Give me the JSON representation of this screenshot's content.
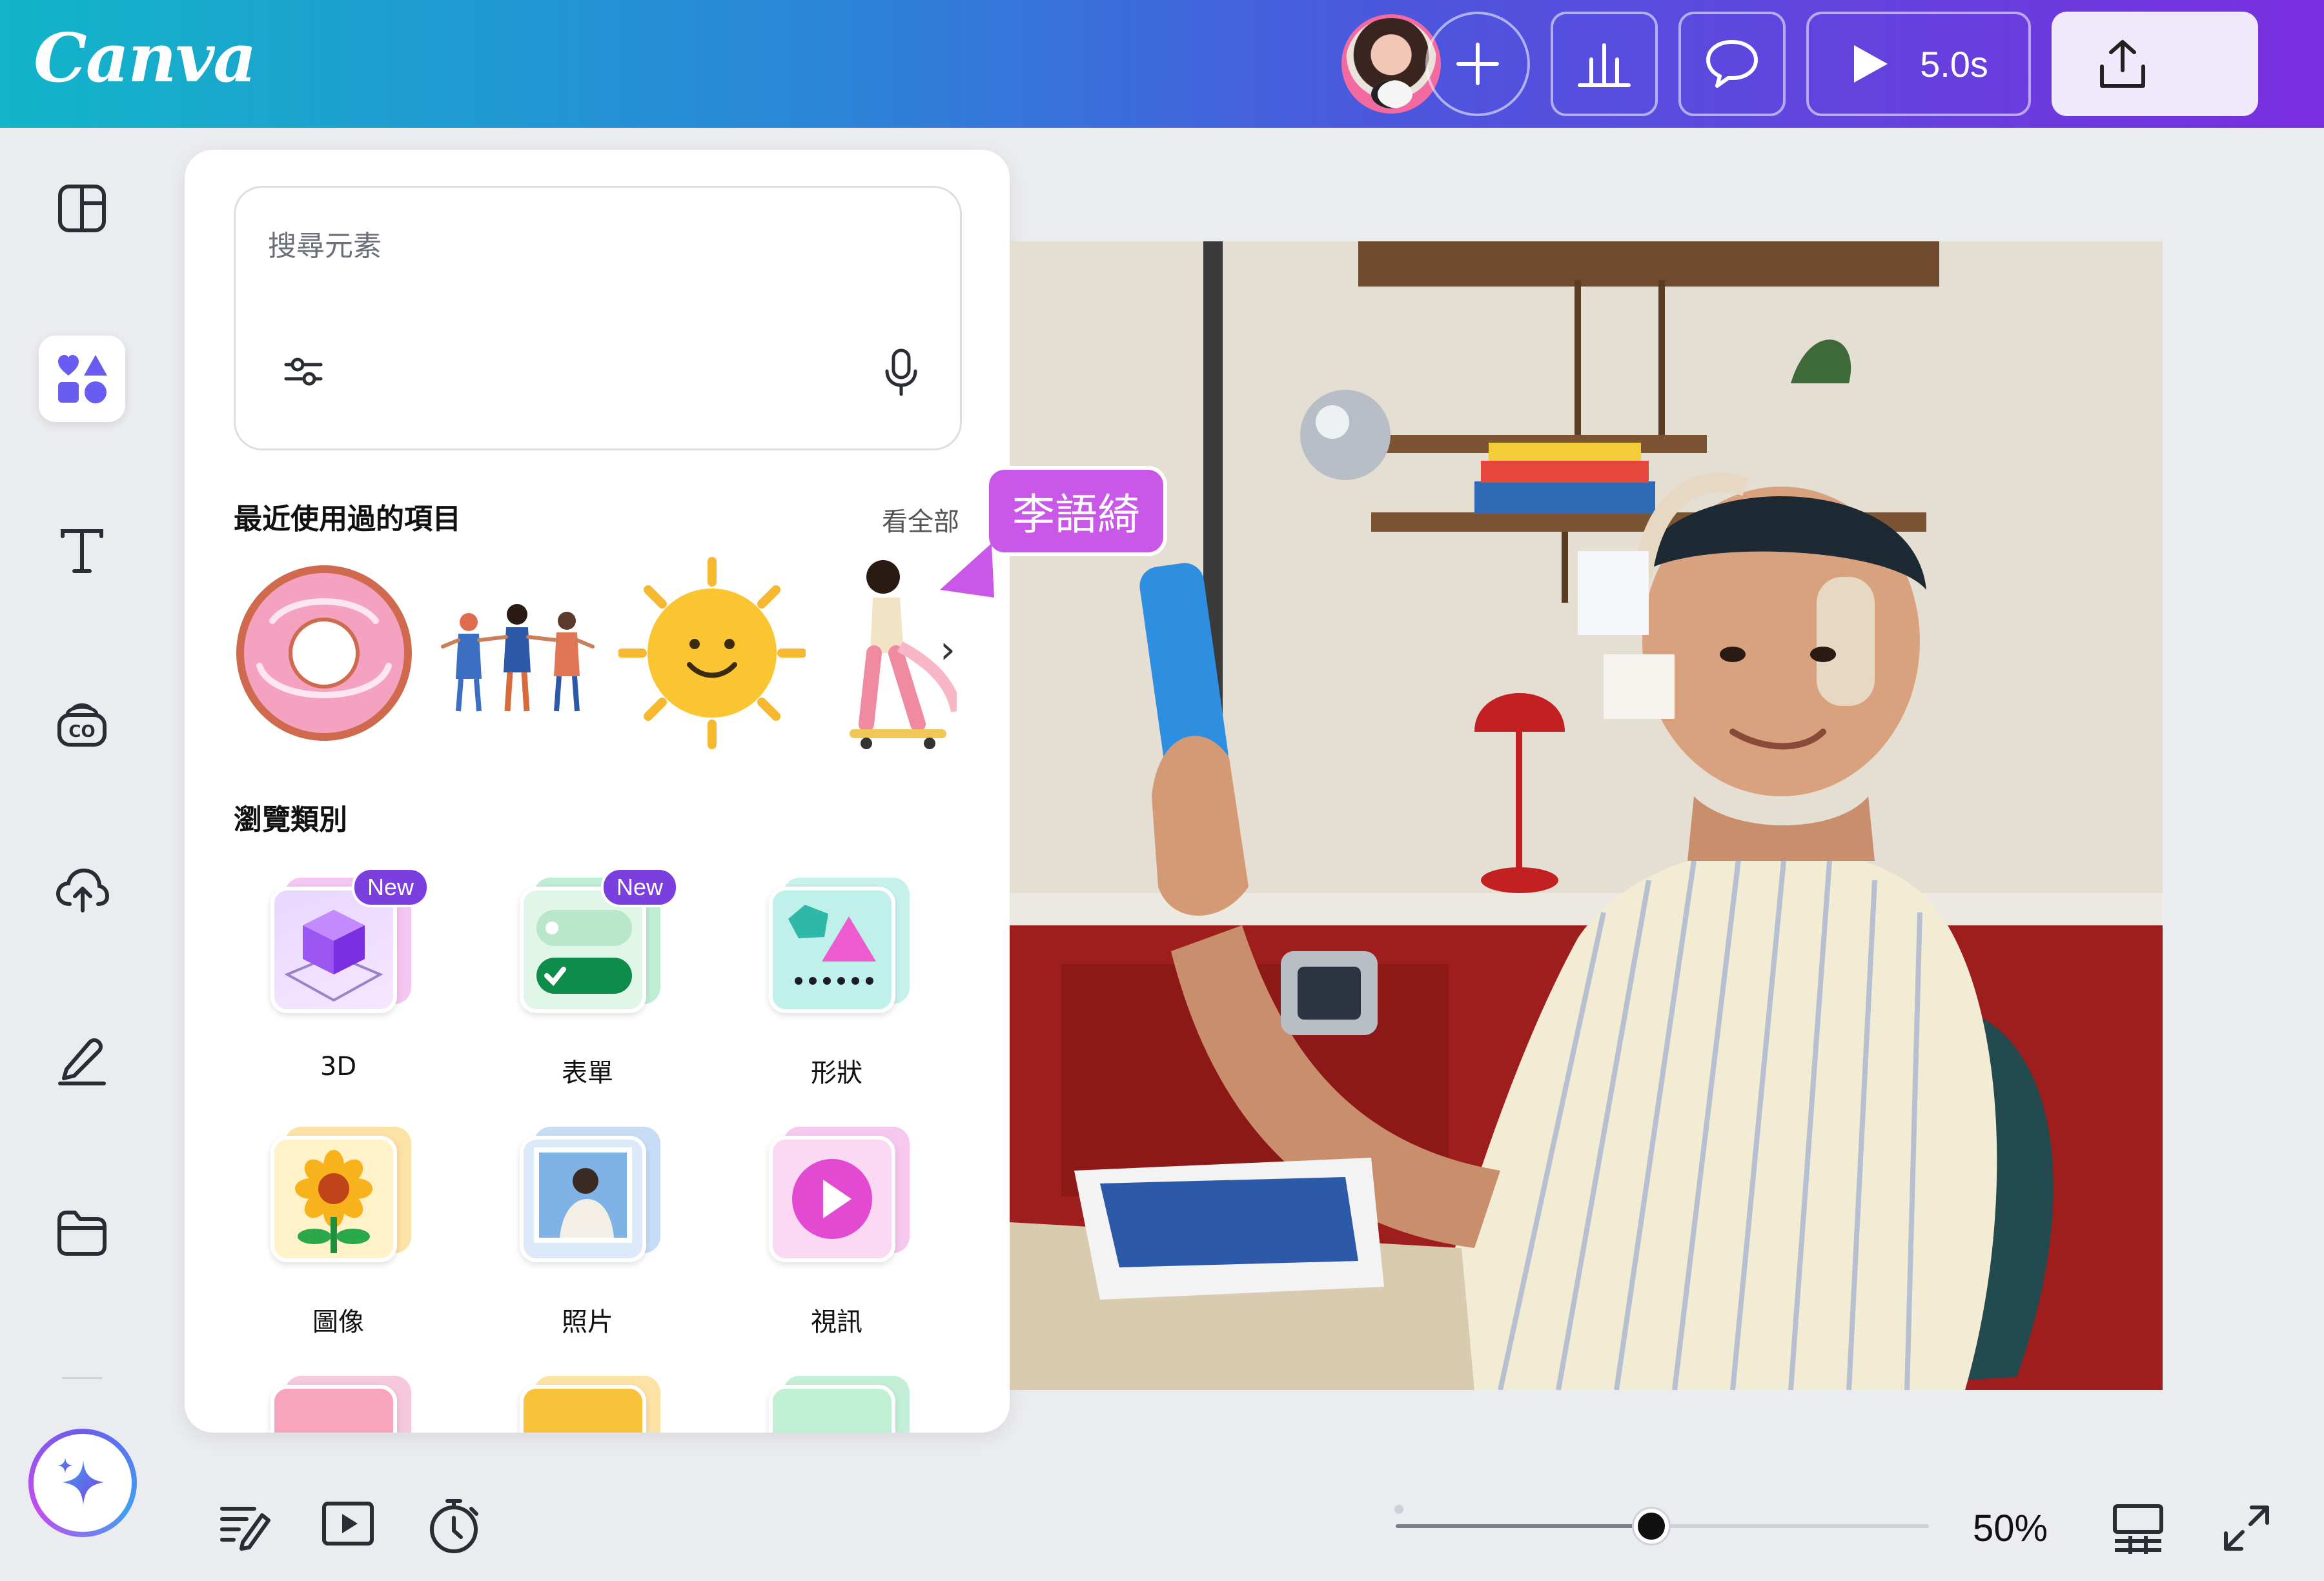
{
  "app": {
    "logo": "Canva"
  },
  "header": {
    "add_collaborator_icon": "plus-icon",
    "insights_icon": "bar-chart-icon",
    "comments_icon": "speech-bubble-icon",
    "play_time": "5.0s",
    "share_icon": "upload-icon"
  },
  "sidebar": {
    "items": [
      {
        "name": "design",
        "icon": "layout-icon"
      },
      {
        "name": "elements",
        "icon": "shapes-icon",
        "active": true
      },
      {
        "name": "text",
        "icon": "text-icon"
      },
      {
        "name": "brand",
        "icon": "brand-kit-icon"
      },
      {
        "name": "uploads",
        "icon": "cloud-upload-icon"
      },
      {
        "name": "draw",
        "icon": "draw-icon"
      },
      {
        "name": "projects",
        "icon": "folder-icon"
      }
    ],
    "magic_icon": "sparkle-icon"
  },
  "panel": {
    "search": {
      "placeholder": "搜尋元素",
      "value": ""
    },
    "recent": {
      "title": "最近使用過的項目",
      "see_all": "看全部",
      "items": [
        "donut",
        "people-holding-hands",
        "smiling-sun",
        "skateboarder"
      ]
    },
    "browse": {
      "title": "瀏覽類別",
      "categories": [
        {
          "label": "3D",
          "badge": "New"
        },
        {
          "label": "表單",
          "badge": "New"
        },
        {
          "label": "形狀"
        },
        {
          "label": "圖像"
        },
        {
          "label": "照片"
        },
        {
          "label": "視訊"
        }
      ]
    }
  },
  "canvas": {
    "collaborator_name": "李語綺"
  },
  "footer": {
    "zoom": {
      "value": "50%",
      "fraction": 0.48
    }
  },
  "colors": {
    "accent": "#7b3fe0",
    "collaborator": "#c957e8",
    "header_start": "#12b5c9",
    "header_end": "#7a2fe0"
  }
}
